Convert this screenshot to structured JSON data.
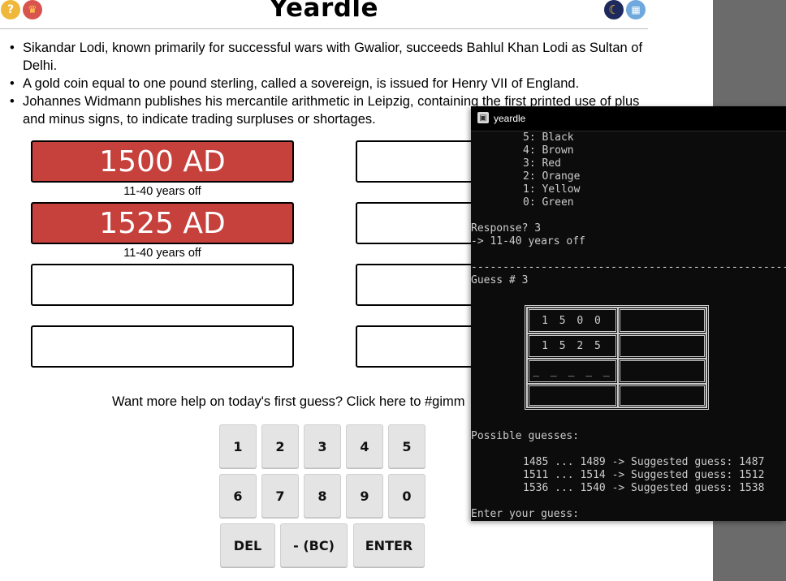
{
  "header": {
    "title": "Yeardle",
    "icons": [
      "help-icon",
      "trophy-icon",
      "dark-mode-moon-icon",
      "calendar-icon"
    ]
  },
  "clues": [
    "Sikandar Lodi, known primarily for successful wars with Gwalior, succeeds Bahlul Khan Lodi as Sultan of Delhi.",
    "A gold coin equal to one pound sterling, called a sovereign, is issued for Henry VII of England.",
    "Johannes Widmann publishes his mercantile arithmetic in Leipzig, containing the first printed use of plus and minus signs, to indicate trading surpluses or shortages."
  ],
  "guesses": [
    {
      "value": "1500 AD",
      "feedback": "11-40 years off"
    },
    {
      "value": "1525 AD",
      "feedback": "11-40 years off"
    }
  ],
  "colors": {
    "guess_box_filled": "#c6403c",
    "page_background": "#ffffff",
    "console_background": "#0c0c0c",
    "console_text": "#cccccc"
  },
  "help_link": "Want more help on today's first guess? Click here to #gimm",
  "keypad": {
    "digits": [
      "1",
      "2",
      "3",
      "4",
      "5",
      "6",
      "7",
      "8",
      "9",
      "0"
    ],
    "del": "DEL",
    "bc": "- (BC)",
    "enter": "ENTER"
  },
  "console": {
    "title": "yeardle",
    "legend": [
      "5: Black",
      "4: Brown",
      "3: Red",
      "2: Orange",
      "1: Yellow",
      "0: Green"
    ],
    "response_prompt": "Response? 3",
    "response_result": "-> 11-40 years off",
    "dashes": "----------------------------------------------------",
    "guess_label": "Guess # 3",
    "grid_cells": [
      "1 5 0 0",
      "1 5 2 5",
      "_ _ _ _ _"
    ],
    "possible_label": "Possible guesses:",
    "possible": [
      "1485 ... 1489 -> Suggested guess: 1487",
      "1511 ... 1514 -> Suggested guess: 1512",
      "1536 ... 1540 -> Suggested guess: 1538"
    ],
    "input_prompt": "Enter your guess:"
  }
}
